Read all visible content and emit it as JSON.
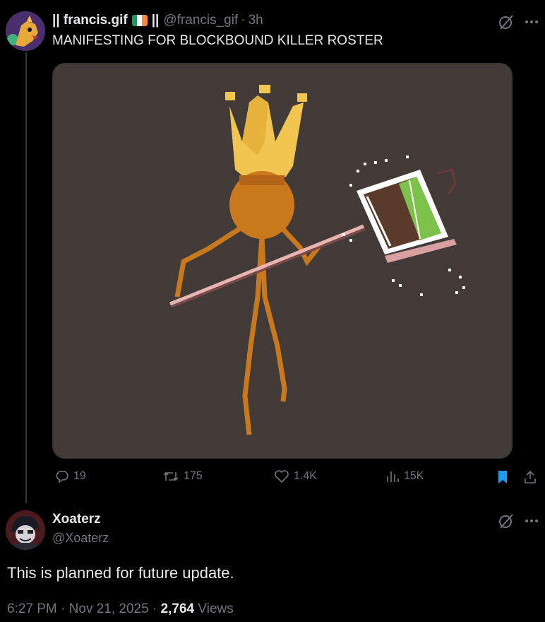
{
  "post": {
    "display_name": "|| francis.gif",
    "name_suffix": "||",
    "handle": "@francis_gif",
    "separator": "·",
    "time": "3h",
    "text": "MANIFESTING FOR BLOCKBOUND KILLER ROSTER",
    "flag_colors": [
      "#169b62",
      "#ffffff",
      "#ff883e"
    ],
    "media_icon": "pixel-art-crowned-character-with-shovel",
    "actions": {
      "replies": "19",
      "reposts": "175",
      "likes": "1.4K",
      "views": "15K",
      "bookmark_color": "#1d9bf0"
    }
  },
  "reply": {
    "display_name": "Xoaterz",
    "handle": "@Xoaterz",
    "text": "This is planned for future update.",
    "time": "6:27 PM",
    "separator": "·",
    "date": "Nov 21, 2025",
    "views_count": "2,764",
    "views_label": "Views"
  },
  "colors": {
    "background": "#000000",
    "text": "#e7e9ea",
    "muted": "#71767b",
    "accent": "#1d9bf0",
    "media_bg": "#423a37"
  }
}
